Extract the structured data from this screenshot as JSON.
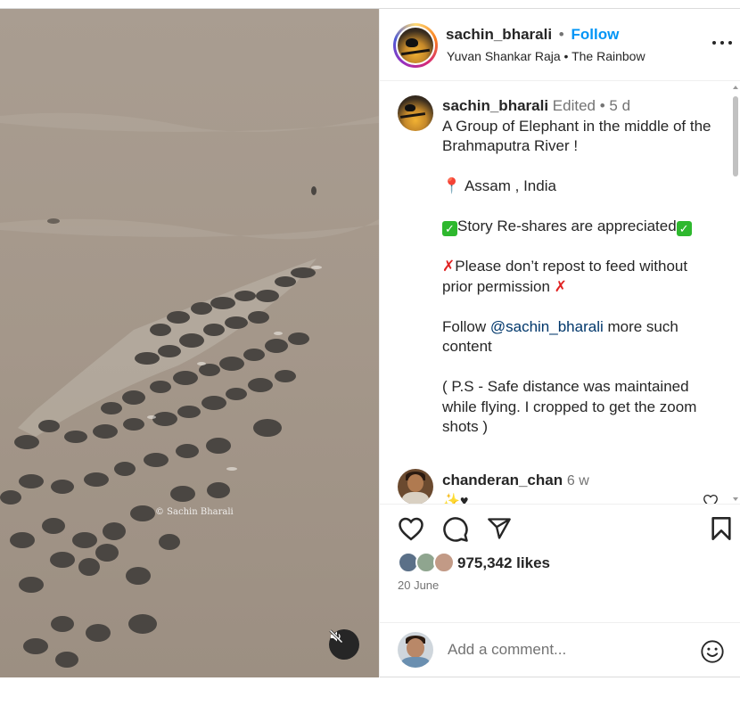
{
  "post": {
    "watermark": "© Sachin Bharali",
    "mute_icon": "speaker-muted-icon"
  },
  "header": {
    "username": "sachin_bharali",
    "separator": "•",
    "follow_label": "Follow",
    "audio_artist": "Yuvan Shankar Raja",
    "audio_separator": "•",
    "audio_track": "The Rainbow",
    "more_icon": "more-options-icon"
  },
  "caption": {
    "username": "sachin_bharali",
    "edited": "Edited",
    "dot": "•",
    "time": "5 d",
    "line1": "A Group of Elephant in the middle of the Brahmaputra River !",
    "location_emoji": "📍",
    "location": " Assam , India",
    "check_emoji": "✓",
    "reshare": "Story Re-shares are appreciated",
    "cross_emoji": "✗",
    "repost": "Please don’t repost to feed without prior permission",
    "follow_prefix": "Follow ",
    "follow_mention": "@sachin_bharali",
    "follow_suffix": " more such content",
    "ps": "( P.S - Safe distance was maintained while flying. I cropped to get the zoom shots )"
  },
  "comment": {
    "username": "chanderan_chan",
    "time": "6 w",
    "text": "✨♥"
  },
  "actions": {
    "like_icon": "heart-icon",
    "comment_icon": "comment-icon",
    "share_icon": "share-icon",
    "save_icon": "bookmark-icon"
  },
  "likes": {
    "count_text": "975,342 likes",
    "date": "20 June"
  },
  "add_comment": {
    "placeholder": "Add a comment...",
    "emoji_icon": "smiley-icon"
  }
}
